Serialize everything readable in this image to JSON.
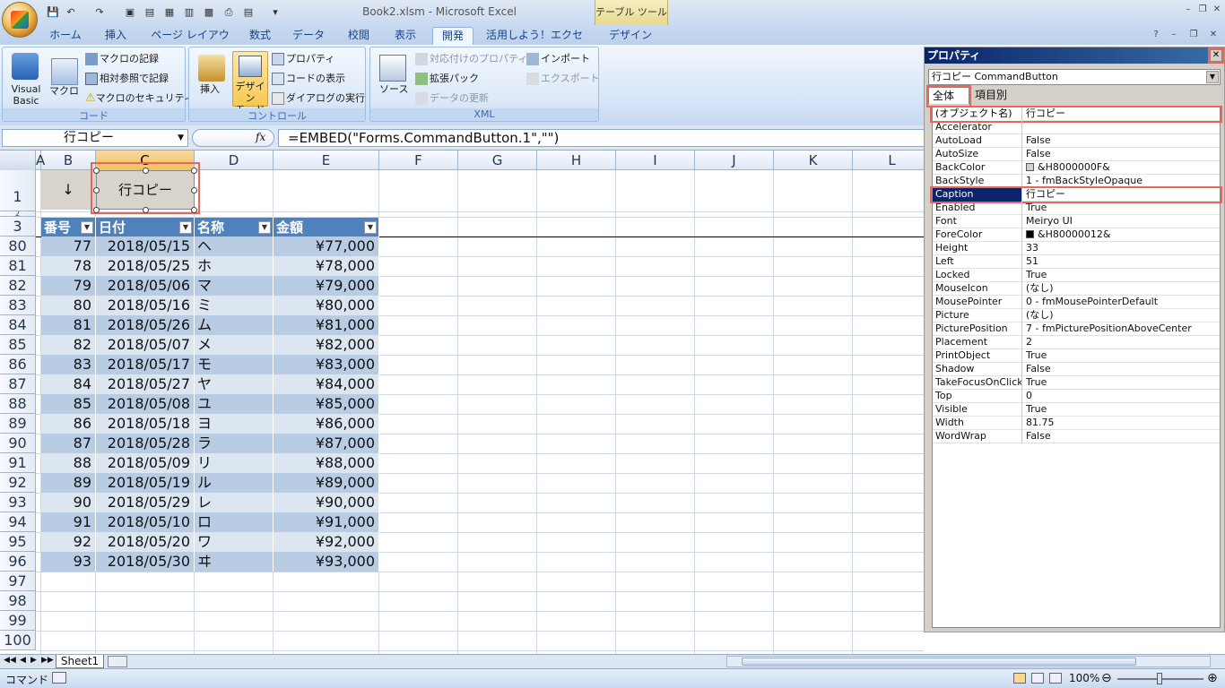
{
  "window": {
    "doc_title": "Book2.xlsm - Microsoft Excel",
    "context_tab_group": "テーブル ツール"
  },
  "tabs": [
    {
      "label": "ホーム"
    },
    {
      "label": "挿入"
    },
    {
      "label": "ページ レイアウト"
    },
    {
      "label": "数式"
    },
    {
      "label": "データ"
    },
    {
      "label": "校閲"
    },
    {
      "label": "表示"
    },
    {
      "label": "開発"
    },
    {
      "label": "活用しよう！エクセル"
    },
    {
      "label": "デザイン"
    }
  ],
  "active_tab": "開発",
  "ribbon": {
    "code": {
      "label": "コード",
      "visual_basic": "Visual\nBasic",
      "macro": "マクロ",
      "record_macro": "マクロの記録",
      "relative_ref": "相対参照で記録",
      "macro_security": "マクロのセキュリティ"
    },
    "controls": {
      "label": "コントロール",
      "insert": "挿入",
      "design_mode": "デザイン\nモード",
      "properties": "プロパティ",
      "view_code": "コードの表示",
      "run_dialog": "ダイアログの実行"
    },
    "xml": {
      "label": "XML",
      "source": "ソース",
      "map_properties": "対応付けのプロパティ",
      "expansion_packs": "拡張パック",
      "refresh_data": "データの更新",
      "import": "インポート",
      "export": "エクスポート"
    }
  },
  "formula_bar": {
    "name_box": "行コピー",
    "fx": "fx",
    "formula": "=EMBED(\"Forms.CommandButton.1\",\"\")"
  },
  "columns": [
    "A",
    "B",
    "C",
    "D",
    "E",
    "F",
    "G",
    "H",
    "I",
    "J",
    "K",
    "L"
  ],
  "sheet_buttons": {
    "arrow": "↓",
    "copy": "行コピー"
  },
  "table": {
    "headers": [
      "番号",
      "日付",
      "名称",
      "金額"
    ],
    "rows": [
      {
        "row": "80",
        "no": "77",
        "date": "2018/05/15",
        "name": "ヘ",
        "amount": "¥77,000"
      },
      {
        "row": "81",
        "no": "78",
        "date": "2018/05/25",
        "name": "ホ",
        "amount": "¥78,000"
      },
      {
        "row": "82",
        "no": "79",
        "date": "2018/05/06",
        "name": "マ",
        "amount": "¥79,000"
      },
      {
        "row": "83",
        "no": "80",
        "date": "2018/05/16",
        "name": "ミ",
        "amount": "¥80,000"
      },
      {
        "row": "84",
        "no": "81",
        "date": "2018/05/26",
        "name": "ム",
        "amount": "¥81,000"
      },
      {
        "row": "85",
        "no": "82",
        "date": "2018/05/07",
        "name": "メ",
        "amount": "¥82,000"
      },
      {
        "row": "86",
        "no": "83",
        "date": "2018/05/17",
        "name": "モ",
        "amount": "¥83,000"
      },
      {
        "row": "87",
        "no": "84",
        "date": "2018/05/27",
        "name": "ヤ",
        "amount": "¥84,000"
      },
      {
        "row": "88",
        "no": "85",
        "date": "2018/05/08",
        "name": "ユ",
        "amount": "¥85,000"
      },
      {
        "row": "89",
        "no": "86",
        "date": "2018/05/18",
        "name": "ヨ",
        "amount": "¥86,000"
      },
      {
        "row": "90",
        "no": "87",
        "date": "2018/05/28",
        "name": "ラ",
        "amount": "¥87,000"
      },
      {
        "row": "91",
        "no": "88",
        "date": "2018/05/09",
        "name": "リ",
        "amount": "¥88,000"
      },
      {
        "row": "92",
        "no": "89",
        "date": "2018/05/19",
        "name": "ル",
        "amount": "¥89,000"
      },
      {
        "row": "93",
        "no": "90",
        "date": "2018/05/29",
        "name": "レ",
        "amount": "¥90,000"
      },
      {
        "row": "94",
        "no": "91",
        "date": "2018/05/10",
        "name": "ロ",
        "amount": "¥91,000"
      },
      {
        "row": "95",
        "no": "92",
        "date": "2018/05/20",
        "name": "ワ",
        "amount": "¥92,000"
      },
      {
        "row": "96",
        "no": "93",
        "date": "2018/05/30",
        "name": "ヰ",
        "amount": "¥93,000"
      }
    ]
  },
  "top_rows": [
    "1",
    "2",
    "3"
  ],
  "empty_rows": [
    "97",
    "98",
    "99",
    "100"
  ],
  "sheet_tab": "Sheet1",
  "status": {
    "mode": "コマンド",
    "zoom": "100%"
  },
  "properties": {
    "title": "プロパティ",
    "object": "行コピー CommandButton",
    "tab_all": "全体",
    "tab_category": "項目別",
    "rows": [
      {
        "name": "(オブジェクト名)",
        "value": "行コピー"
      },
      {
        "name": "Accelerator",
        "value": ""
      },
      {
        "name": "AutoLoad",
        "value": "False"
      },
      {
        "name": "AutoSize",
        "value": "False"
      },
      {
        "name": "BackColor",
        "value": "&H8000000F&",
        "swatch": "#d4d0c8"
      },
      {
        "name": "BackStyle",
        "value": "1 - fmBackStyleOpaque"
      },
      {
        "name": "Caption",
        "value": "行コピー"
      },
      {
        "name": "Enabled",
        "value": "True"
      },
      {
        "name": "Font",
        "value": "Meiryo UI"
      },
      {
        "name": "ForeColor",
        "value": "&H80000012&",
        "swatch": "#000000"
      },
      {
        "name": "Height",
        "value": "33"
      },
      {
        "name": "Left",
        "value": "51"
      },
      {
        "name": "Locked",
        "value": "True"
      },
      {
        "name": "MouseIcon",
        "value": "(なし)"
      },
      {
        "name": "MousePointer",
        "value": "0 - fmMousePointerDefault"
      },
      {
        "name": "Picture",
        "value": "(なし)"
      },
      {
        "name": "PicturePosition",
        "value": "7 - fmPicturePositionAboveCenter"
      },
      {
        "name": "Placement",
        "value": "2"
      },
      {
        "name": "PrintObject",
        "value": "True"
      },
      {
        "name": "Shadow",
        "value": "False"
      },
      {
        "name": "TakeFocusOnClick",
        "value": "True"
      },
      {
        "name": "Top",
        "value": "0"
      },
      {
        "name": "Visible",
        "value": "True"
      },
      {
        "name": "Width",
        "value": "81.75"
      },
      {
        "name": "WordWrap",
        "value": "False"
      }
    ]
  },
  "colors": {
    "table_header": "#4f81bd",
    "band_dark": "#b8cce4",
    "band_light": "#dce6f1",
    "highlight": "#e8675a"
  }
}
